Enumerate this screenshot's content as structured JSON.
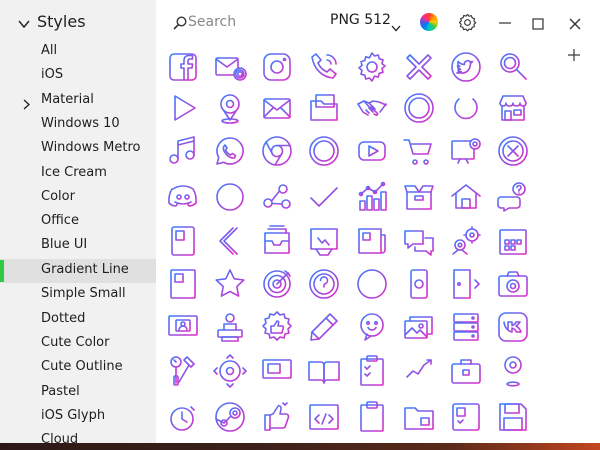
{
  "theme": {
    "accent": "#2ecc40",
    "icon_gradient_start": "#3a7dff",
    "icon_gradient_end": "#e02cc8",
    "sidebar_bg": "#f1f1f1"
  },
  "sidebar": {
    "title": "Styles",
    "items": [
      {
        "label": "All"
      },
      {
        "label": "iOS"
      },
      {
        "label": "Material",
        "expandable": true
      },
      {
        "label": "Windows 10"
      },
      {
        "label": "Windows Metro"
      },
      {
        "label": "Ice Cream"
      },
      {
        "label": "Color"
      },
      {
        "label": "Office"
      },
      {
        "label": "Blue UI"
      },
      {
        "label": "Gradient Line",
        "selected": true
      },
      {
        "label": "Simple Small"
      },
      {
        "label": "Dotted"
      },
      {
        "label": "Cute Color"
      },
      {
        "label": "Cute Outline"
      },
      {
        "label": "Pastel"
      },
      {
        "label": "iOS Glyph"
      },
      {
        "label": "Cloud"
      }
    ]
  },
  "toolbar": {
    "search_placeholder": "Search",
    "format_label": "PNG 512",
    "icons": [
      "search-icon",
      "chevron-down-icon",
      "color-wheel-icon",
      "gear-icon",
      "minimize-icon",
      "maximize-icon",
      "close-icon",
      "plus-icon"
    ]
  },
  "icon_grid": {
    "rows": [
      [
        "facebook",
        "email-at",
        "instagram",
        "phone",
        "settings",
        "close",
        "twitter",
        "search"
      ],
      [
        "play",
        "location-pin",
        "envelope",
        "folder-documents",
        "handshake",
        "list-circle",
        "power",
        "shop"
      ],
      [
        "music",
        "whatsapp",
        "chrome",
        "plus-circle",
        "youtube",
        "shopping-cart",
        "computer-settings",
        "cancel-circle"
      ],
      [
        "discord",
        "circle",
        "share",
        "checkmark",
        "bar-chart",
        "package",
        "home",
        "help-chat"
      ],
      [
        "id-badge",
        "back-arrow",
        "inbox-tray",
        "calendar-chart",
        "news",
        "chat-bubbles",
        "engineering",
        "calendar"
      ],
      [
        "report",
        "star",
        "target",
        "help-circle",
        "add-circle",
        "smartphone",
        "logout",
        "camera"
      ],
      [
        "computer-user",
        "printer",
        "thumbs-up-badge",
        "pencil",
        "emoji-chat",
        "photo-gallery",
        "server",
        "vk"
      ],
      [
        "tools",
        "pan-control",
        "monitor",
        "book",
        "checklist",
        "line-chart",
        "toolbox",
        "map-pin"
      ],
      [
        "timer",
        "steam",
        "like",
        "code",
        "clipboard",
        "folder",
        "task-board",
        "floppy-disk"
      ]
    ]
  }
}
